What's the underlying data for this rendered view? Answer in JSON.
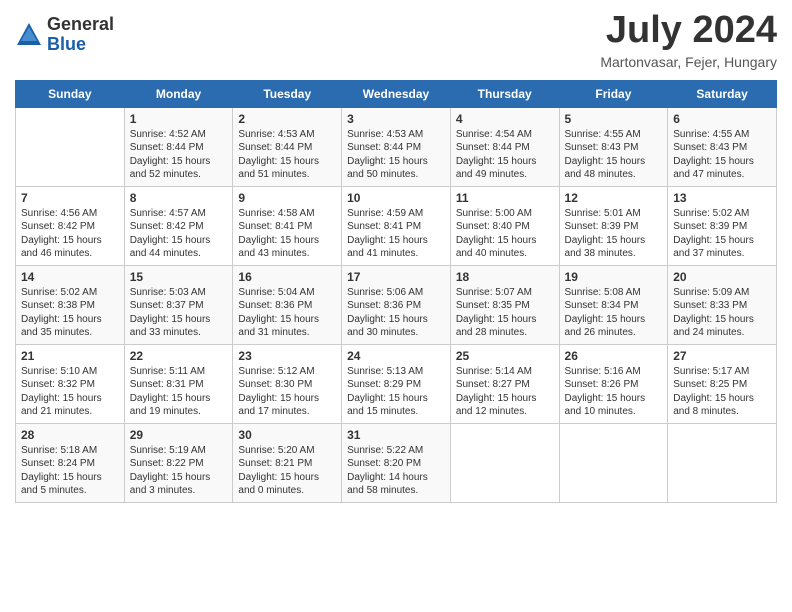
{
  "header": {
    "logo": {
      "general": "General",
      "blue": "Blue"
    },
    "title": "July 2024",
    "location": "Martonvasar, Fejer, Hungary"
  },
  "columns": [
    "Sunday",
    "Monday",
    "Tuesday",
    "Wednesday",
    "Thursday",
    "Friday",
    "Saturday"
  ],
  "weeks": [
    [
      {
        "day": "",
        "info": ""
      },
      {
        "day": "1",
        "info": "Sunrise: 4:52 AM\nSunset: 8:44 PM\nDaylight: 15 hours\nand 52 minutes."
      },
      {
        "day": "2",
        "info": "Sunrise: 4:53 AM\nSunset: 8:44 PM\nDaylight: 15 hours\nand 51 minutes."
      },
      {
        "day": "3",
        "info": "Sunrise: 4:53 AM\nSunset: 8:44 PM\nDaylight: 15 hours\nand 50 minutes."
      },
      {
        "day": "4",
        "info": "Sunrise: 4:54 AM\nSunset: 8:44 PM\nDaylight: 15 hours\nand 49 minutes."
      },
      {
        "day": "5",
        "info": "Sunrise: 4:55 AM\nSunset: 8:43 PM\nDaylight: 15 hours\nand 48 minutes."
      },
      {
        "day": "6",
        "info": "Sunrise: 4:55 AM\nSunset: 8:43 PM\nDaylight: 15 hours\nand 47 minutes."
      }
    ],
    [
      {
        "day": "7",
        "info": "Sunrise: 4:56 AM\nSunset: 8:42 PM\nDaylight: 15 hours\nand 46 minutes."
      },
      {
        "day": "8",
        "info": "Sunrise: 4:57 AM\nSunset: 8:42 PM\nDaylight: 15 hours\nand 44 minutes."
      },
      {
        "day": "9",
        "info": "Sunrise: 4:58 AM\nSunset: 8:41 PM\nDaylight: 15 hours\nand 43 minutes."
      },
      {
        "day": "10",
        "info": "Sunrise: 4:59 AM\nSunset: 8:41 PM\nDaylight: 15 hours\nand 41 minutes."
      },
      {
        "day": "11",
        "info": "Sunrise: 5:00 AM\nSunset: 8:40 PM\nDaylight: 15 hours\nand 40 minutes."
      },
      {
        "day": "12",
        "info": "Sunrise: 5:01 AM\nSunset: 8:39 PM\nDaylight: 15 hours\nand 38 minutes."
      },
      {
        "day": "13",
        "info": "Sunrise: 5:02 AM\nSunset: 8:39 PM\nDaylight: 15 hours\nand 37 minutes."
      }
    ],
    [
      {
        "day": "14",
        "info": "Sunrise: 5:02 AM\nSunset: 8:38 PM\nDaylight: 15 hours\nand 35 minutes."
      },
      {
        "day": "15",
        "info": "Sunrise: 5:03 AM\nSunset: 8:37 PM\nDaylight: 15 hours\nand 33 minutes."
      },
      {
        "day": "16",
        "info": "Sunrise: 5:04 AM\nSunset: 8:36 PM\nDaylight: 15 hours\nand 31 minutes."
      },
      {
        "day": "17",
        "info": "Sunrise: 5:06 AM\nSunset: 8:36 PM\nDaylight: 15 hours\nand 30 minutes."
      },
      {
        "day": "18",
        "info": "Sunrise: 5:07 AM\nSunset: 8:35 PM\nDaylight: 15 hours\nand 28 minutes."
      },
      {
        "day": "19",
        "info": "Sunrise: 5:08 AM\nSunset: 8:34 PM\nDaylight: 15 hours\nand 26 minutes."
      },
      {
        "day": "20",
        "info": "Sunrise: 5:09 AM\nSunset: 8:33 PM\nDaylight: 15 hours\nand 24 minutes."
      }
    ],
    [
      {
        "day": "21",
        "info": "Sunrise: 5:10 AM\nSunset: 8:32 PM\nDaylight: 15 hours\nand 21 minutes."
      },
      {
        "day": "22",
        "info": "Sunrise: 5:11 AM\nSunset: 8:31 PM\nDaylight: 15 hours\nand 19 minutes."
      },
      {
        "day": "23",
        "info": "Sunrise: 5:12 AM\nSunset: 8:30 PM\nDaylight: 15 hours\nand 17 minutes."
      },
      {
        "day": "24",
        "info": "Sunrise: 5:13 AM\nSunset: 8:29 PM\nDaylight: 15 hours\nand 15 minutes."
      },
      {
        "day": "25",
        "info": "Sunrise: 5:14 AM\nSunset: 8:27 PM\nDaylight: 15 hours\nand 12 minutes."
      },
      {
        "day": "26",
        "info": "Sunrise: 5:16 AM\nSunset: 8:26 PM\nDaylight: 15 hours\nand 10 minutes."
      },
      {
        "day": "27",
        "info": "Sunrise: 5:17 AM\nSunset: 8:25 PM\nDaylight: 15 hours\nand 8 minutes."
      }
    ],
    [
      {
        "day": "28",
        "info": "Sunrise: 5:18 AM\nSunset: 8:24 PM\nDaylight: 15 hours\nand 5 minutes."
      },
      {
        "day": "29",
        "info": "Sunrise: 5:19 AM\nSunset: 8:22 PM\nDaylight: 15 hours\nand 3 minutes."
      },
      {
        "day": "30",
        "info": "Sunrise: 5:20 AM\nSunset: 8:21 PM\nDaylight: 15 hours\nand 0 minutes."
      },
      {
        "day": "31",
        "info": "Sunrise: 5:22 AM\nSunset: 8:20 PM\nDaylight: 14 hours\nand 58 minutes."
      },
      {
        "day": "",
        "info": ""
      },
      {
        "day": "",
        "info": ""
      },
      {
        "day": "",
        "info": ""
      }
    ]
  ]
}
